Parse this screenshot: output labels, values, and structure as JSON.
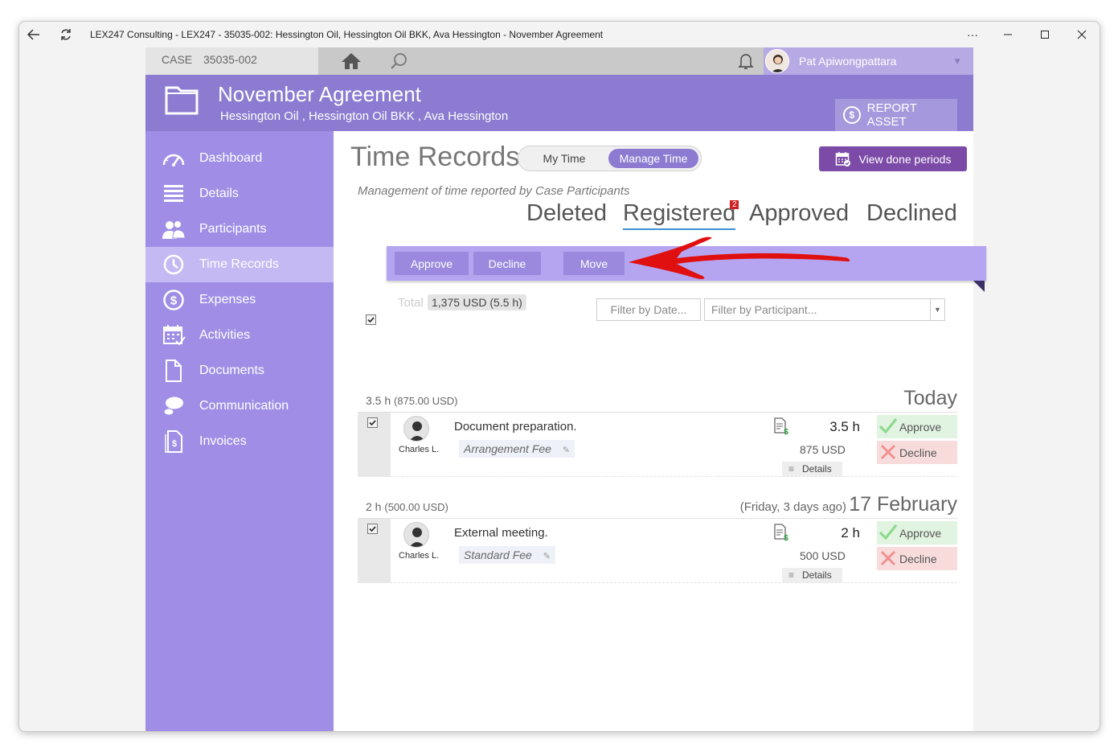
{
  "window": {
    "title": "LEX247 Consulting - LEX247 - 35035-002: Hessington Oil, Hessington Oil BKK, Ava Hessington - November Agreement",
    "more": "···"
  },
  "topbar": {
    "case_label": "CASE",
    "case_number": "35035-002",
    "user_name": "Pat Apiwongpattara"
  },
  "header": {
    "title": "November Agreement",
    "subtitle": "Hessington Oil ,  Hessington Oil BKK ,  Ava Hessington",
    "report_asset": "REPORT ASSET"
  },
  "sidebar": {
    "items": [
      {
        "label": "Dashboard",
        "icon": "dashboard-icon"
      },
      {
        "label": "Details",
        "icon": "details-icon"
      },
      {
        "label": "Participants",
        "icon": "participants-icon"
      },
      {
        "label": "Time Records",
        "icon": "clock-icon",
        "active": true
      },
      {
        "label": "Expenses",
        "icon": "dollar-icon"
      },
      {
        "label": "Activities",
        "icon": "calendar-icon"
      },
      {
        "label": "Documents",
        "icon": "document-icon"
      },
      {
        "label": "Communication",
        "icon": "chat-icon"
      },
      {
        "label": "Invoices",
        "icon": "invoice-icon"
      }
    ]
  },
  "main": {
    "title": "Time Records",
    "toggle": {
      "my_time": "My Time",
      "manage_time": "Manage Time"
    },
    "view_done_periods": "View done periods",
    "subtitle": "Management of time reported by Case Participants",
    "tabs": {
      "deleted": "Deleted",
      "registered": "Registered",
      "registered_badge": "2",
      "approved": "Approved",
      "declined": "Declined"
    },
    "actions": {
      "approve": "Approve",
      "decline": "Decline",
      "move": "Move"
    },
    "total_label": "Total",
    "total_value": "1,375 USD (5.5 h)",
    "filter_date": "Filter by Date...",
    "filter_participant": "Filter by Participant..."
  },
  "groups": [
    {
      "hours": "3.5 h",
      "amount": "(875.00 USD)",
      "ago": "",
      "date": "Today",
      "record": {
        "person": "Charles L.",
        "description": "Document preparation.",
        "fee": "Arrangement Fee",
        "hours": "3.5 h",
        "amount": "875 USD",
        "details": "Details",
        "approve": "Approve",
        "decline": "Decline"
      }
    },
    {
      "hours": "2 h",
      "amount": "(500.00 USD)",
      "ago": "(Friday, 3 days ago)",
      "date": "17 February",
      "record": {
        "person": "Charles L.",
        "description": "External meeting.",
        "fee": "Standard Fee",
        "hours": "2 h",
        "amount": "500 USD",
        "details": "Details",
        "approve": "Approve",
        "decline": "Decline"
      }
    }
  ],
  "colors": {
    "accent": "#8c7bd0",
    "sidebar": "#a08ee6",
    "active_nav": "#c5b9f3",
    "action_bar": "#b5a5f0",
    "done_button": "#7c4ba8",
    "annotation_arrow": "#e01010"
  }
}
